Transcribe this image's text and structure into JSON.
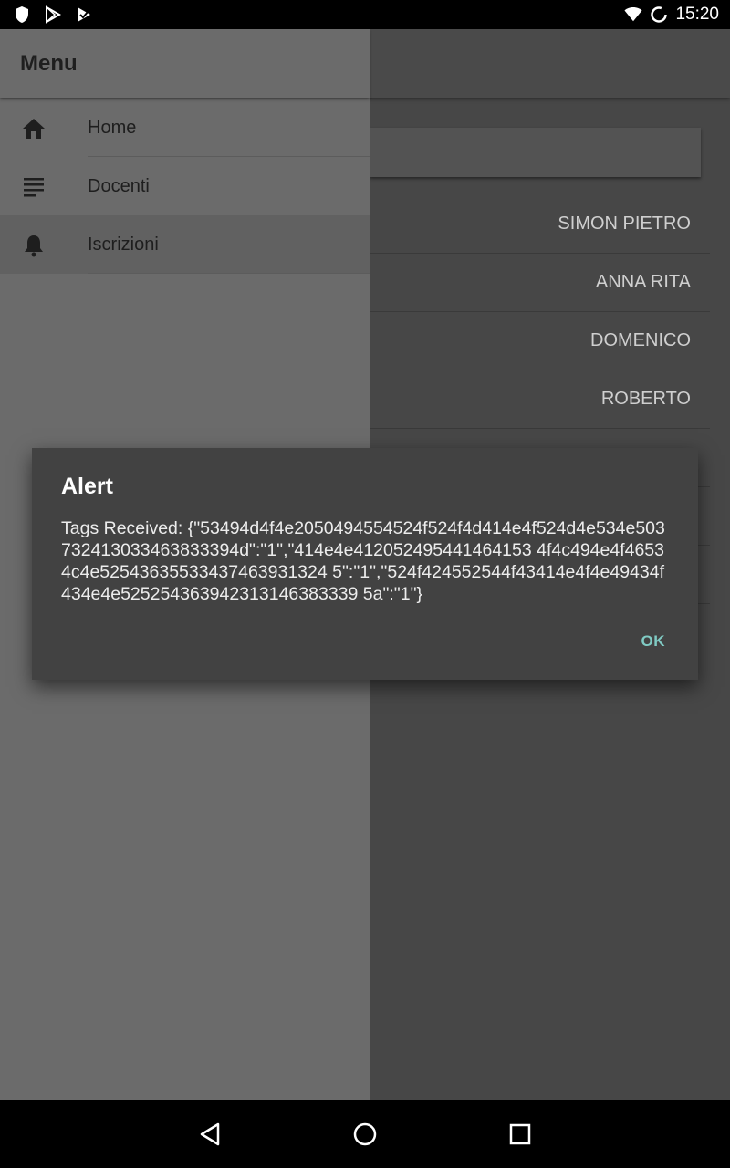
{
  "status_bar": {
    "time": "15:20",
    "left_icons": [
      "shield-icon",
      "play-store-icon",
      "play-store-check-icon"
    ],
    "right_icons": [
      "wifi-icon",
      "sync-icon"
    ]
  },
  "drawer": {
    "title": "Menu",
    "items": [
      {
        "label": "Home",
        "icon": "home-icon",
        "active": false
      },
      {
        "label": "Docenti",
        "icon": "list-icon",
        "active": false
      },
      {
        "label": "Iscrizioni",
        "icon": "bell-icon",
        "active": true
      }
    ]
  },
  "list": {
    "rows": [
      "SIMON PIETRO",
      "ANNA RITA",
      "DOMENICO",
      "ROBERTO",
      "",
      "",
      "",
      ""
    ]
  },
  "dialog": {
    "title": "Alert",
    "message": "Tags Received: {\"53494d4f4e2050494554524f524f4d414e4f524d4e534e503732413033463833394d\":\"1\",\"414e4e412052495441464153 4f4c494e4f46534c4e52543635533437463931324 5\":\"1\",\"524f424552544f43414e4f4e49434f434e4e525254363942313146383339 5a\":\"1\"}",
    "ok_label": "OK"
  },
  "colors": {
    "dialog_bg": "#424242",
    "accent": "#80cbc4",
    "drawer_bg": "#6b6b6b",
    "app_bg": "#474747"
  }
}
